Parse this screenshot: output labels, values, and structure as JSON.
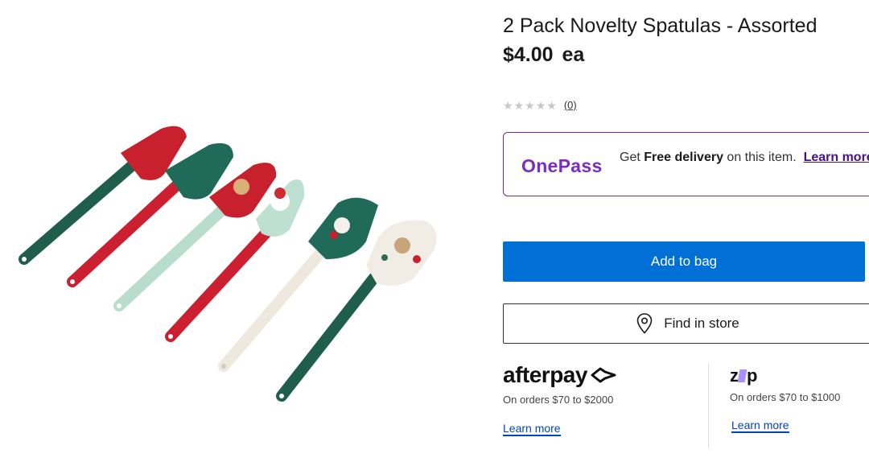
{
  "product": {
    "title": "2 Pack Novelty Spatulas - Assorted",
    "price": "$4.00",
    "price_unit": "ea",
    "image_alt": "Six Christmas novelty spatulas in red, green, mint and cream"
  },
  "rating": {
    "stars_filled": 0,
    "stars_total": 5,
    "review_count": "(0)"
  },
  "onepass": {
    "logo": "OnePass",
    "text_prefix": "Get ",
    "text_bold": "Free delivery",
    "text_suffix": " on this item.",
    "link": "Learn more",
    "color": "#7b2cc4"
  },
  "actions": {
    "add_to_bag": "Add to bag",
    "find_in_store": "Find in store",
    "primary_color": "#0070d6"
  },
  "afterpay": {
    "logo": "afterpay",
    "note": "On orders $70 to $2000",
    "learn_more": "Learn more"
  },
  "zip": {
    "logo_left": "z",
    "logo_right": "p",
    "note": "On orders $70 to $1000",
    "learn_more": "Learn more"
  }
}
